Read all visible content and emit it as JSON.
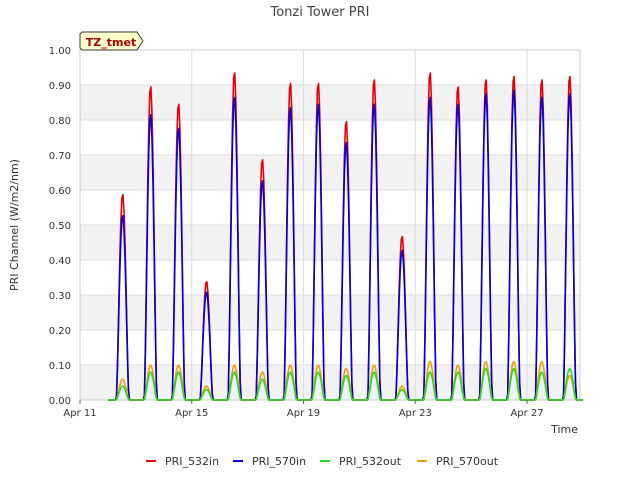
{
  "chart_data": {
    "type": "line",
    "title": "Tonzi Tower PRI",
    "xlabel": "Time",
    "ylabel": "PRI Channel (W/m2/nm)",
    "ylim": [
      0,
      1.0
    ],
    "yticks": [
      "0.00",
      "0.10",
      "0.20",
      "0.30",
      "0.40",
      "0.50",
      "0.60",
      "0.70",
      "0.80",
      "0.90",
      "1.00"
    ],
    "xlim": [
      0,
      17
    ],
    "xticks": [
      {
        "label": "Apr 11",
        "value": 0
      },
      {
        "label": "Apr 15",
        "value": 4
      },
      {
        "label": "Apr 19",
        "value": 8
      },
      {
        "label": "Apr 23",
        "value": 12
      },
      {
        "label": "Apr 27",
        "value": 16
      }
    ],
    "grid": true,
    "annotation": "TZ_tmet",
    "legend_position": "bottom",
    "series": [
      {
        "name": "PRI_532in",
        "color": "#ee0000"
      },
      {
        "name": "PRI_570in",
        "color": "#0000dd"
      },
      {
        "name": "PRI_532out",
        "color": "#22dd22"
      },
      {
        "name": "PRI_570out",
        "color": "#f0a000"
      }
    ],
    "daily_peaks": [
      {
        "day": 1,
        "PRI_532in": 0.59,
        "PRI_570in": 0.53,
        "PRI_532out": 0.04,
        "PRI_570out": 0.06
      },
      {
        "day": 2,
        "PRI_532in": 0.9,
        "PRI_570in": 0.82,
        "PRI_532out": 0.08,
        "PRI_570out": 0.1
      },
      {
        "day": 3,
        "PRI_532in": 0.85,
        "PRI_570in": 0.78,
        "PRI_532out": 0.08,
        "PRI_570out": 0.1
      },
      {
        "day": 4,
        "PRI_532in": 0.34,
        "PRI_570in": 0.31,
        "PRI_532out": 0.03,
        "PRI_570out": 0.04
      },
      {
        "day": 5,
        "PRI_532in": 0.94,
        "PRI_570in": 0.87,
        "PRI_532out": 0.08,
        "PRI_570out": 0.1
      },
      {
        "day": 6,
        "PRI_532in": 0.69,
        "PRI_570in": 0.63,
        "PRI_532out": 0.06,
        "PRI_570out": 0.08
      },
      {
        "day": 7,
        "PRI_532in": 0.91,
        "PRI_570in": 0.84,
        "PRI_532out": 0.08,
        "PRI_570out": 0.1
      },
      {
        "day": 8,
        "PRI_532in": 0.91,
        "PRI_570in": 0.85,
        "PRI_532out": 0.08,
        "PRI_570out": 0.1
      },
      {
        "day": 9,
        "PRI_532in": 0.8,
        "PRI_570in": 0.74,
        "PRI_532out": 0.07,
        "PRI_570out": 0.09
      },
      {
        "day": 10,
        "PRI_532in": 0.92,
        "PRI_570in": 0.85,
        "PRI_532out": 0.08,
        "PRI_570out": 0.1
      },
      {
        "day": 11,
        "PRI_532in": 0.47,
        "PRI_570in": 0.43,
        "PRI_532out": 0.03,
        "PRI_570out": 0.04
      },
      {
        "day": 12,
        "PRI_532in": 0.94,
        "PRI_570in": 0.87,
        "PRI_532out": 0.08,
        "PRI_570out": 0.11
      },
      {
        "day": 13,
        "PRI_532in": 0.9,
        "PRI_570in": 0.85,
        "PRI_532out": 0.08,
        "PRI_570out": 0.1
      },
      {
        "day": 14,
        "PRI_532in": 0.92,
        "PRI_570in": 0.88,
        "PRI_532out": 0.09,
        "PRI_570out": 0.11
      },
      {
        "day": 15,
        "PRI_532in": 0.93,
        "PRI_570in": 0.89,
        "PRI_532out": 0.09,
        "PRI_570out": 0.11
      },
      {
        "day": 16,
        "PRI_532in": 0.92,
        "PRI_570in": 0.87,
        "PRI_532out": 0.08,
        "PRI_570out": 0.11
      },
      {
        "day": 17,
        "PRI_532in": 0.93,
        "PRI_570in": 0.88,
        "PRI_532out": 0.09,
        "PRI_570out": 0.07
      }
    ]
  }
}
